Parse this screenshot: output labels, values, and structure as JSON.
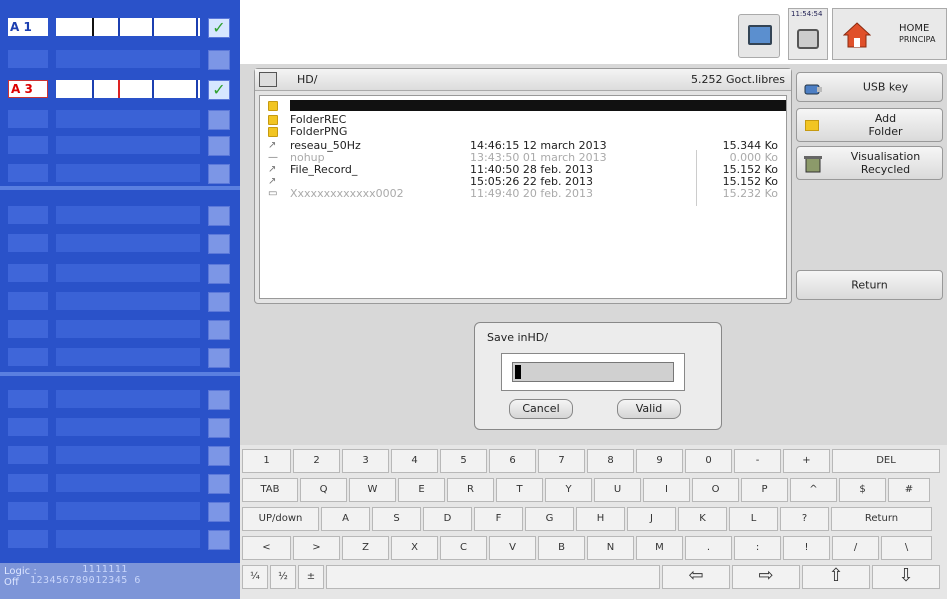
{
  "left_panel": {
    "channel_a1": "A 1",
    "channel_a3": "A 3",
    "check_glyph": "✓",
    "logic_label_1": "Logic :",
    "logic_label_2": "Off",
    "logic_digits_top": "        1111111",
    "logic_digits_bottom": "123456789012345 6"
  },
  "topbar": {
    "clock": "11:54:54",
    "home_line1": "HOME",
    "home_line2": "PRINCIPA"
  },
  "file_browser": {
    "path": "HD/",
    "free_space": "5.252 Goct.libres",
    "files": [
      {
        "icon": "folder-icon",
        "name": "FolderREC",
        "date": "",
        "size": "",
        "dim": false
      },
      {
        "icon": "folder-icon",
        "name": "FolderPNG",
        "date": "",
        "size": "",
        "dim": false
      },
      {
        "icon": "record-file-icon",
        "name": "reseau_50Hz",
        "date": "14:46:15 12 march 2013",
        "size": "15.344 Ko",
        "dim": false
      },
      {
        "icon": "text-file-icon",
        "name": "nohup",
        "date": "13:43:50 01 march 2013",
        "size": "0.000 Ko",
        "dim": true
      },
      {
        "icon": "record-file-icon",
        "name": "File_Record_",
        "date": "11:40:50 28 feb. 2013",
        "size": "15.152 Ko",
        "dim": false
      },
      {
        "icon": "record-file-icon",
        "name": "",
        "date": "15:05:26 22 feb. 2013",
        "size": "15.152 Ko",
        "dim": false
      },
      {
        "icon": "image-file-icon",
        "name": "Xxxxxxxxxxxxx0002",
        "date": "11:49:40 20 feb. 2013",
        "size": "15.232 Ko",
        "dim": true
      }
    ]
  },
  "side_buttons": {
    "usb": "USB key",
    "add_folder_1": "Add",
    "add_folder_2": "Folder",
    "recycled_1": "Visualisation",
    "recycled_2": "Recycled",
    "return": "Return"
  },
  "save_dialog": {
    "title": "Save inHD/",
    "input_value": "",
    "cancel": "Cancel",
    "valid": "Valid"
  },
  "keyboard": {
    "row1": [
      "1",
      "2",
      "3",
      "4",
      "5",
      "6",
      "7",
      "8",
      "9",
      "0",
      "-",
      "+",
      "DEL"
    ],
    "row2": [
      "TAB",
      "Q",
      "W",
      "E",
      "R",
      "T",
      "Y",
      "U",
      "I",
      "O",
      "P",
      "^",
      "$",
      "#"
    ],
    "row3": [
      "UP/down",
      "A",
      "S",
      "D",
      "F",
      "G",
      "H",
      "J",
      "K",
      "L",
      "?",
      "Return"
    ],
    "row4": [
      "<",
      ">",
      "Z",
      "X",
      "C",
      "V",
      "B",
      "N",
      "M",
      ".",
      ":",
      "!",
      "/",
      "\\"
    ],
    "row5": [
      "¼",
      "½",
      "±",
      "",
      "⇦",
      "⇨",
      "⇧",
      "⇩"
    ]
  }
}
